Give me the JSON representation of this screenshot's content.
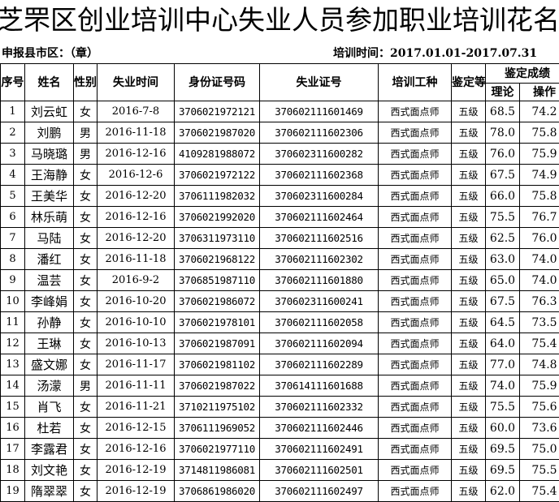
{
  "title": "芝罘区创业培训中心失业人员参加职业培训花名册",
  "meta": {
    "left": "申报县市区：（章）",
    "right": "培训时间：2017.01.01-2017.07.31"
  },
  "headers": {
    "no": "序号",
    "name": "姓名",
    "gender": "性别",
    "date": "失业时间",
    "id": "身份证号码",
    "cert": "失业证号",
    "job": "培训工种",
    "level": "鉴定等级",
    "score": "鉴定成绩",
    "theory": "理论",
    "practice": "操作"
  },
  "rows": [
    {
      "no": "1",
      "name": "刘云虹",
      "gender": "女",
      "date": "2016-7-8",
      "id": "3706021972121",
      "cert": "370602111601469",
      "job": "西式面点师",
      "level": "五级",
      "theory": "68.5",
      "practice": "74.2"
    },
    {
      "no": "2",
      "name": "刘鹏",
      "gender": "男",
      "date": "2016-11-18",
      "id": "3706021987020",
      "cert": "370602111602306",
      "job": "西式面点师",
      "level": "五级",
      "theory": "78.0",
      "practice": "75.8"
    },
    {
      "no": "3",
      "name": "马晓璐",
      "gender": "男",
      "date": "2016-12-16",
      "id": "4109281988072",
      "cert": "370602311600282",
      "job": "西式面点师",
      "level": "五级",
      "theory": "76.0",
      "practice": "75.9"
    },
    {
      "no": "4",
      "name": "王海静",
      "gender": "女",
      "date": "2016-12-6",
      "id": "3706021972122",
      "cert": "370602111602368",
      "job": "西式面点师",
      "level": "五级",
      "theory": "67.5",
      "practice": "74.9"
    },
    {
      "no": "5",
      "name": "王美华",
      "gender": "女",
      "date": "2016-12-20",
      "id": "3706111982032",
      "cert": "370602311600284",
      "job": "西式面点师",
      "level": "五级",
      "theory": "66.0",
      "practice": "75.8"
    },
    {
      "no": "6",
      "name": "林乐萌",
      "gender": "女",
      "date": "2016-12-16",
      "id": "3706021992020",
      "cert": "370602111602464",
      "job": "西式面点师",
      "level": "五级",
      "theory": "75.5",
      "practice": "76.7"
    },
    {
      "no": "7",
      "name": "马陆",
      "gender": "女",
      "date": "2016-12-20",
      "id": "3706311973110",
      "cert": "370602111602516",
      "job": "西式面点师",
      "level": "五级",
      "theory": "62.5",
      "practice": "76.0"
    },
    {
      "no": "8",
      "name": "潘红",
      "gender": "女",
      "date": "2016-11-18",
      "id": "3706021968122",
      "cert": "370602111602302",
      "job": "西式面点师",
      "level": "五级",
      "theory": "63.0",
      "practice": "74.0"
    },
    {
      "no": "9",
      "name": "温芸",
      "gender": "女",
      "date": "2016-9-2",
      "id": "3706851987110",
      "cert": "370602111601880",
      "job": "西式面点师",
      "level": "五级",
      "theory": "65.0",
      "practice": "74.0"
    },
    {
      "no": "10",
      "name": "李峰娟",
      "gender": "女",
      "date": "2016-10-20",
      "id": "3706021986072",
      "cert": "370602311600241",
      "job": "西式面点师",
      "level": "五级",
      "theory": "67.5",
      "practice": "76.3"
    },
    {
      "no": "11",
      "name": "孙静",
      "gender": "女",
      "date": "2016-10-10",
      "id": "3706021978101",
      "cert": "370602111602058",
      "job": "西式面点师",
      "level": "五级",
      "theory": "64.5",
      "practice": "73.5"
    },
    {
      "no": "12",
      "name": "王琳",
      "gender": "女",
      "date": "2016-10-13",
      "id": "3706021987091",
      "cert": "370602111602094",
      "job": "西式面点师",
      "level": "五级",
      "theory": "64.0",
      "practice": "75.4"
    },
    {
      "no": "13",
      "name": "盛文娜",
      "gender": "女",
      "date": "2016-11-17",
      "id": "3706021981102",
      "cert": "370602111602289",
      "job": "西式面点师",
      "level": "五级",
      "theory": "77.0",
      "practice": "74.8"
    },
    {
      "no": "14",
      "name": "汤濛",
      "gender": "男",
      "date": "2016-11-11",
      "id": "3706021987022",
      "cert": "370614111601688",
      "job": "西式面点师",
      "level": "五级",
      "theory": "74.0",
      "practice": "75.9"
    },
    {
      "no": "15",
      "name": "肖飞",
      "gender": "女",
      "date": "2016-11-21",
      "id": "3710211975102",
      "cert": "370602111602332",
      "job": "西式面点师",
      "level": "五级",
      "theory": "75.5",
      "practice": "75.6"
    },
    {
      "no": "16",
      "name": "杜若",
      "gender": "女",
      "date": "2016-12-15",
      "id": "3706111969052",
      "cert": "370602111602446",
      "job": "西式面点师",
      "level": "五级",
      "theory": "60.0",
      "practice": "73.6"
    },
    {
      "no": "17",
      "name": "李露君",
      "gender": "女",
      "date": "2016-12-16",
      "id": "3706021977110",
      "cert": "370602111602491",
      "job": "西式面点师",
      "level": "五级",
      "theory": "69.5",
      "practice": "75.0"
    },
    {
      "no": "18",
      "name": "刘文艳",
      "gender": "女",
      "date": "2016-12-19",
      "id": "3714811986081",
      "cert": "370602111602501",
      "job": "西式面点师",
      "level": "五级",
      "theory": "69.5",
      "practice": "75.5"
    },
    {
      "no": "19",
      "name": "隋翠翠",
      "gender": "女",
      "date": "2016-12-19",
      "id": "3706861986020",
      "cert": "370602111602497",
      "job": "西式面点师",
      "level": "五级",
      "theory": "62.0",
      "practice": "75.4"
    }
  ]
}
